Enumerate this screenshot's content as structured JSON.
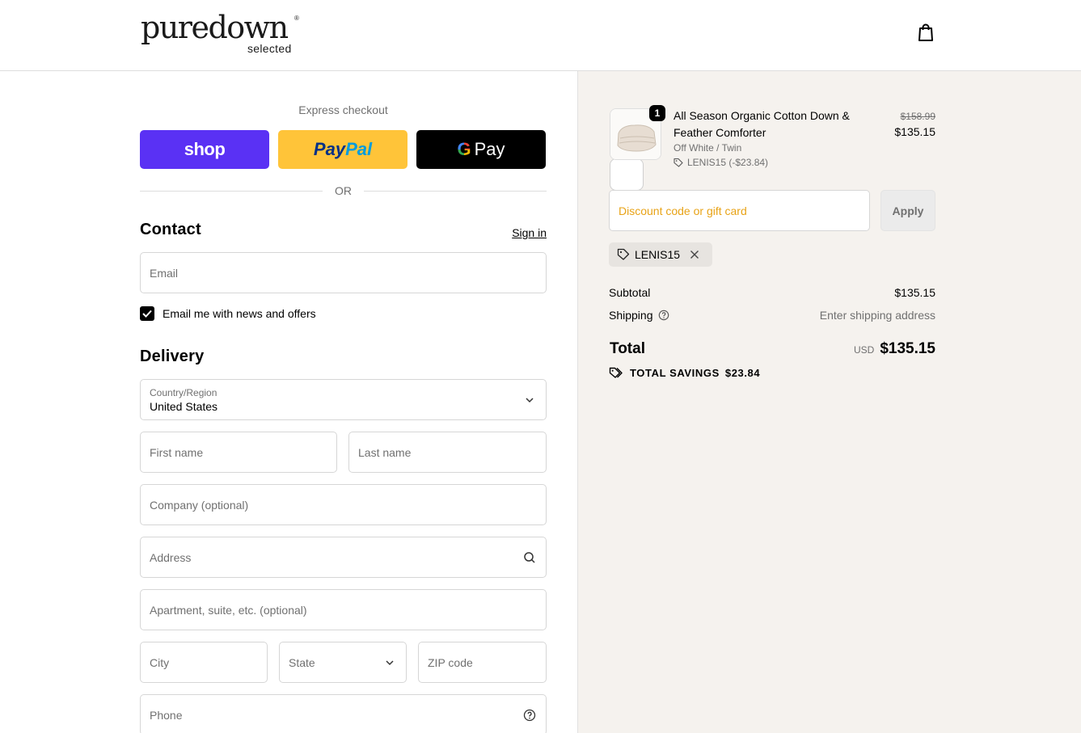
{
  "header": {
    "logo_main": "puredown",
    "logo_reg": "®",
    "logo_sub": "selected",
    "cart_icon": "shopping-bag-icon"
  },
  "express": {
    "label": "Express checkout",
    "shop_label": "shop",
    "paypal_label_1": "Pay",
    "paypal_label_2": "Pal",
    "gpay_g": "G",
    "gpay_label": "Pay",
    "or_label": "OR"
  },
  "contact": {
    "title": "Contact",
    "sign_in": "Sign in",
    "email_placeholder": "Email",
    "newsletter_label": "Email me with news and offers",
    "newsletter_checked": true
  },
  "delivery": {
    "title": "Delivery",
    "country_label": "Country/Region",
    "country_value": "United States",
    "first_name_placeholder": "First name",
    "last_name_placeholder": "Last name",
    "company_placeholder": "Company (optional)",
    "address_placeholder": "Address",
    "apartment_placeholder": "Apartment, suite, etc. (optional)",
    "city_placeholder": "City",
    "state_placeholder": "State",
    "zip_placeholder": "ZIP code",
    "phone_placeholder": "Phone"
  },
  "summary": {
    "item": {
      "quantity": "1",
      "title": "All Season Organic Cotton Down & Feather Comforter",
      "variant": "Off White / Twin",
      "discount": "LENIS15 (-$23.84)",
      "original_price": "$158.99",
      "price": "$135.15"
    },
    "discount_placeholder": "Discount code or gift card",
    "apply_label": "Apply",
    "applied_code": "LENIS15",
    "subtotal_label": "Subtotal",
    "subtotal_value": "$135.15",
    "shipping_label": "Shipping",
    "shipping_value": "Enter shipping address",
    "total_label": "Total",
    "total_currency": "USD",
    "total_value": "$135.15",
    "savings_label": "TOTAL SAVINGS",
    "savings_value": "$23.84"
  },
  "colors": {
    "shop_pay": "#5a31f4",
    "paypal": "#ffc439",
    "summary_bg": "#f5f2ee",
    "discount_placeholder": "#e8a317"
  }
}
